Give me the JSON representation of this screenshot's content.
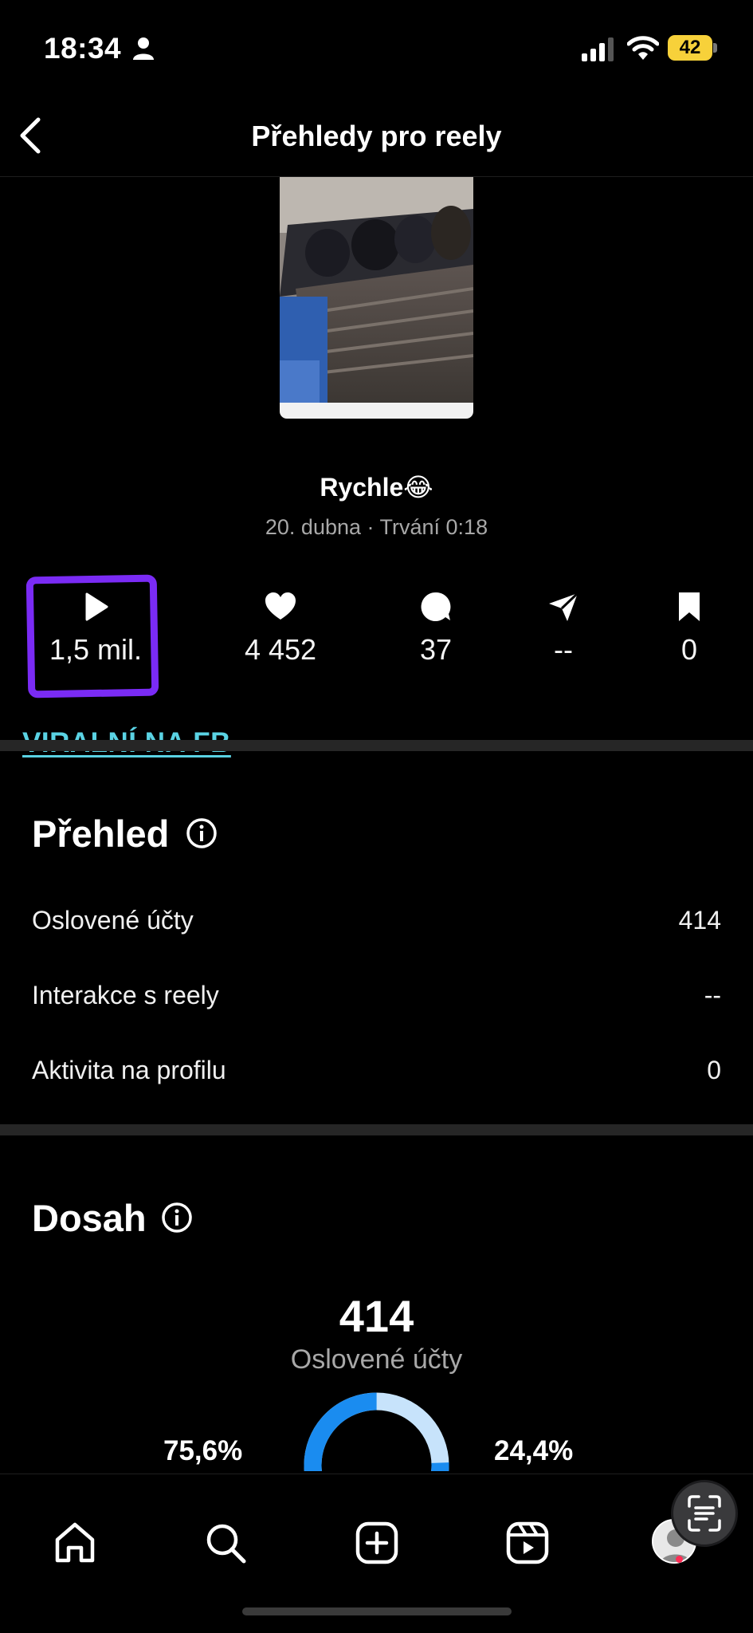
{
  "status_bar": {
    "time": "18:34",
    "battery": "42"
  },
  "header": {
    "title": "Přehledy pro reely"
  },
  "reel": {
    "title": "Rychle😂",
    "meta": "20. dubna · Trvání 0:18"
  },
  "stats": {
    "plays": "1,5 mil.",
    "likes": "4 452",
    "comments": "37",
    "shares": "--",
    "saves": "0"
  },
  "annotation": {
    "viral_text": "VIRALNÍ NA FB",
    "highlight_color": "#7a2bf5",
    "link_color": "#5ad3e4"
  },
  "overview": {
    "title": "Přehled",
    "rows": [
      {
        "label": "Oslovené účty",
        "value": "414"
      },
      {
        "label": "Interakce s reely",
        "value": "--"
      },
      {
        "label": "Aktivita na profilu",
        "value": "0"
      }
    ]
  },
  "reach": {
    "title": "Dosah",
    "number": "414",
    "label": "Oslovené účty",
    "left_percent": "75,6%",
    "right_percent": "24,4%",
    "followers_fraction": 0.756,
    "colors": {
      "primary": "#1a8cf0",
      "secondary": "#c7e3fb"
    }
  },
  "icons": {
    "tabs": [
      "home-icon",
      "search-icon",
      "create-icon",
      "reels-icon",
      "profile-avatar"
    ],
    "stats": [
      "play-icon",
      "heart-icon",
      "comment-icon",
      "share-icon",
      "bookmark-icon"
    ]
  }
}
